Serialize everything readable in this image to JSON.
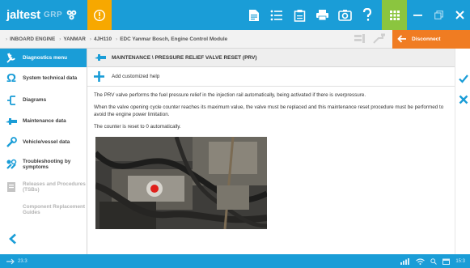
{
  "brand": {
    "name": "jaltest",
    "sub": "GRP"
  },
  "breadcrumb": [
    {
      "label": "INBOARD ENGINE"
    },
    {
      "label": "YANMAR"
    },
    {
      "label": "4JH110"
    },
    {
      "label": "EDC Yanmar Bosch, Engine Control Module"
    }
  ],
  "actions": {
    "disconnect_label": "Disconnect"
  },
  "sidebar": {
    "items": [
      {
        "label": "Diagnostics menu",
        "icon": "wrench-icon",
        "state": "active"
      },
      {
        "label": "System technical data",
        "icon": "omega-icon",
        "state": "normal"
      },
      {
        "label": "Diagrams",
        "icon": "diagram-icon",
        "state": "normal"
      },
      {
        "label": "Maintenance data",
        "icon": "maintenance-icon",
        "state": "normal"
      },
      {
        "label": "Vehicle/vessel data",
        "icon": "vehicle-icon",
        "state": "normal"
      },
      {
        "label": "Troubleshooting by symptoms",
        "icon": "troubleshoot-icon",
        "state": "normal"
      },
      {
        "label": "Releases and Procedures (TSBs)",
        "icon": "releases-icon",
        "state": "disabled"
      },
      {
        "label": "Component Replacement Guides",
        "icon": "none",
        "state": "disabled"
      }
    ]
  },
  "main": {
    "section_title": "MAINTENANCE \\ PRESSURE RELIEF VALVE RESET (PRV)",
    "add_help_label": "Add customized help",
    "paragraphs": [
      "The PRV valve performs the fuel pressure relief in the injection rail automatically, being activated if there is overpressure.",
      "When the valve opening cycle counter reaches its maximum value, the valve must be replaced and this maintenance reset procedure must be performed to avoid the engine power limitation.",
      "The counter is reset to 0 automatically."
    ]
  },
  "status": {
    "version": "23.3",
    "time": "15:3"
  },
  "colors": {
    "primary": "#1a9dd7",
    "alert": "#f7a800",
    "grid": "#8bc53f",
    "disconnect": "#f07c22",
    "confirm": "#1a9dd7"
  }
}
